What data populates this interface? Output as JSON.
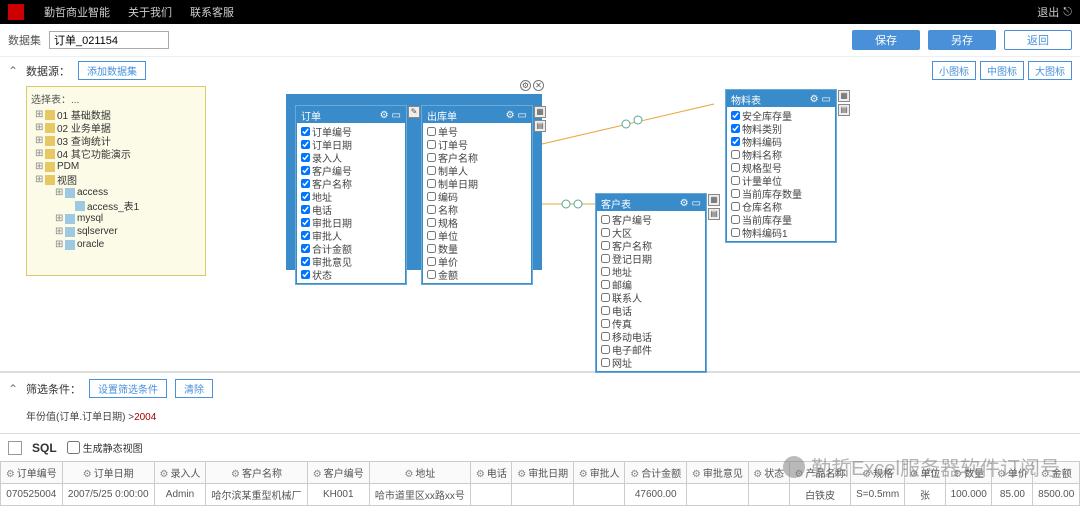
{
  "top": {
    "menu": [
      "勤哲商业智能",
      "关于我们",
      "联系客服"
    ],
    "logout": "退出"
  },
  "row1": {
    "label": "数据集",
    "value": "订单_021154",
    "save": "保存",
    "saveas": "另存",
    "back": "返回"
  },
  "row2": {
    "src": "数据源：",
    "add": "添加数据集",
    "small": "小图标",
    "mid": "中图标",
    "big": "大图标"
  },
  "tree": {
    "title": "选择表：...",
    "items": [
      {
        "t": "01 基础数据",
        "k": "f"
      },
      {
        "t": "02 业务单据",
        "k": "f"
      },
      {
        "t": "03 查询统计",
        "k": "f"
      },
      {
        "t": "04 其它功能演示",
        "k": "f"
      },
      {
        "t": "PDM",
        "k": "f"
      },
      {
        "t": "视图",
        "k": "f"
      },
      {
        "t": "access",
        "k": "d"
      },
      {
        "t": "access_表1",
        "k": "s"
      },
      {
        "t": "mysql",
        "k": "d"
      },
      {
        "t": "sqlserver",
        "k": "d"
      },
      {
        "t": "oracle",
        "k": "d"
      }
    ]
  },
  "boxes": {
    "order": {
      "title": "订单",
      "fields": [
        "订单编号",
        "订单日期",
        "录入人",
        "客户编号",
        "客户名称",
        "地址",
        "电话",
        "审批日期",
        "审批人",
        "合计金额",
        "审批意见",
        "状态"
      ]
    },
    "out": {
      "title": "出库单",
      "fields": [
        "单号",
        "订单号",
        "客户名称",
        "制单人",
        "制单日期",
        "编码",
        "名称",
        "规格",
        "单位",
        "数量",
        "单价",
        "金额"
      ]
    },
    "cust": {
      "title": "客户表",
      "fields": [
        "客户编号",
        "大区",
        "客户名称",
        "登记日期",
        "地址",
        "邮编",
        "联系人",
        "电话",
        "传真",
        "移动电话",
        "电子邮件",
        "网址"
      ]
    },
    "mat": {
      "title": "物料表",
      "fields": [
        "安全库存量",
        "物料类别",
        "物料编码",
        "物料名称",
        "规格型号",
        "计量单位",
        "当前库存数量",
        "仓库名称",
        "当前库存量",
        "物料编码1"
      ]
    }
  },
  "filter": {
    "label": "筛选条件：",
    "set": "设置筛选条件",
    "clear": "清除",
    "expr_a": "年份值(订单.订单日期) >",
    "expr_b": "2004"
  },
  "sql": {
    "label": "SQL",
    "chk": "生成静态视图"
  },
  "grid": {
    "cols": [
      "订单编号",
      "订单日期",
      "录入人",
      "客户名称",
      "客户编号",
      "地址",
      "电话",
      "审批日期",
      "审批人",
      "合计金额",
      "审批意见",
      "状态",
      "产品名称",
      "规格",
      "单位",
      "数量",
      "单价",
      "金额"
    ],
    "row": [
      "070525004",
      "2007/5/25 0:00:00",
      "Admin",
      "哈尔滨某重型机械厂",
      "KH001",
      "哈市道里区xx路xx号",
      "",
      "",
      "",
      "47600.00",
      "",
      "",
      "白铁皮",
      "S=0.5mm",
      "张",
      "100.000",
      "85.00",
      "8500.00"
    ]
  },
  "wm": "勤哲Excel服务器软件订阅号"
}
